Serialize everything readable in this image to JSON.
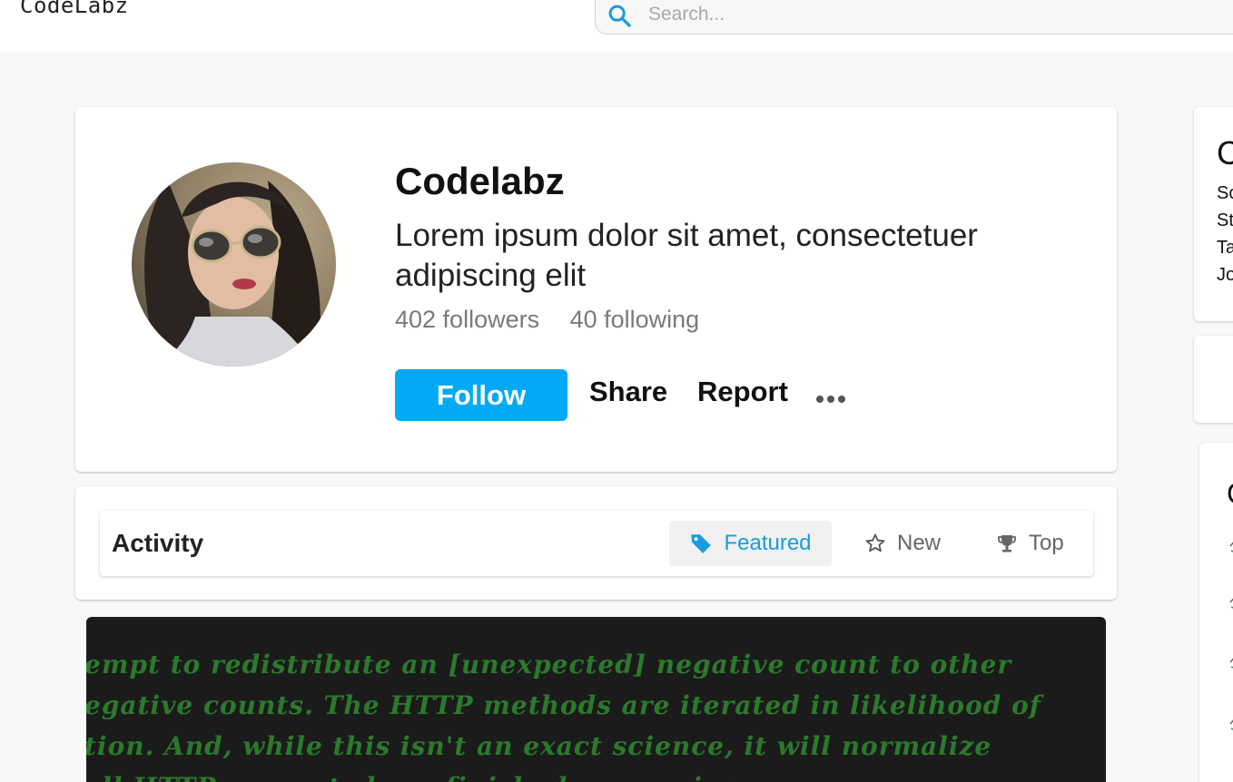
{
  "header": {
    "logo_text": "CodeLabz",
    "search": {
      "placeholder": "Search...",
      "value": ""
    }
  },
  "profile": {
    "name": "Codelabz",
    "bio": "Lorem ipsum dolor sit amet, consectetuer adipiscing elit",
    "followers": "402 followers",
    "following": "40 following",
    "follow_label": "Follow",
    "share_label": "Share",
    "report_label": "Report",
    "more_icon": "more-horizontal-icon"
  },
  "activity": {
    "title": "Activity",
    "tabs": [
      {
        "label": "Featured",
        "icon": "tag-icon",
        "active": true
      },
      {
        "label": "New",
        "icon": "star-outline-icon",
        "active": false
      },
      {
        "label": "Top",
        "icon": "trophy-icon",
        "active": false
      }
    ]
  },
  "code_preview": {
    "lines": [
      "empt to redistribute an [unexpected] negative count to other",
      "egative counts. The HTTP methods are iterated in likelihood of",
      "tion. And, while this isn't an exact science, it will normalize",
      "all HTTP requests have finished processing."
    ]
  },
  "right_panel": {
    "card1": {
      "title": "C",
      "items": [
        "So",
        "St",
        "Ta",
        "Jo"
      ]
    },
    "card3": {
      "title": "C"
    }
  },
  "colors": {
    "accent": "#03a9f4",
    "featured_tab_text": "#1a9be0",
    "code_background": "#1b1b1b",
    "code_text": "#2b7a2c"
  }
}
